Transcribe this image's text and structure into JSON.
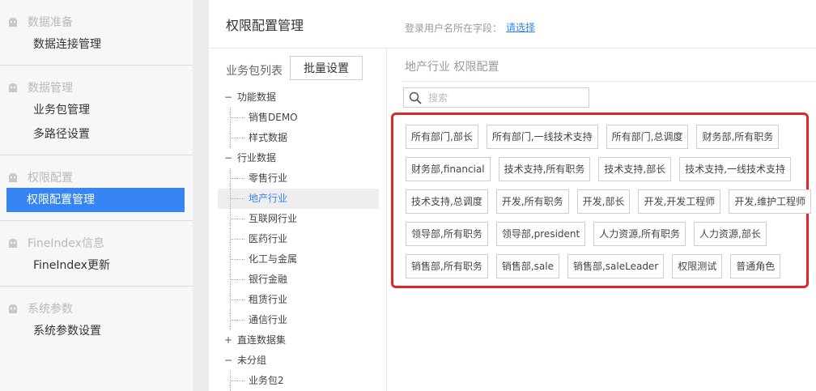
{
  "sidebar": {
    "groups": [
      {
        "header": "数据准备",
        "items": [
          {
            "label": "数据连接管理",
            "active": false
          }
        ]
      },
      {
        "header": "数据管理",
        "items": [
          {
            "label": "业务包管理",
            "active": false
          },
          {
            "label": "多路径设置",
            "active": false
          }
        ]
      },
      {
        "header": "权限配置",
        "items": [
          {
            "label": "权限配置管理",
            "active": true
          }
        ]
      },
      {
        "header": "FineIndex信息",
        "items": [
          {
            "label": "FineIndex更新",
            "active": false
          }
        ]
      },
      {
        "header": "系统参数",
        "items": [
          {
            "label": "系统参数设置",
            "active": false
          }
        ]
      }
    ]
  },
  "topbar": {
    "title": "权限配置管理",
    "field_label": "登录用户名所在字段：",
    "field_link": "请选择"
  },
  "leftpane": {
    "list_label": "业务包列表",
    "batch_button": "批量设置"
  },
  "tree": [
    {
      "label": "功能数据",
      "type": "parent",
      "toggle": "−"
    },
    {
      "label": "销售DEMO",
      "type": "child"
    },
    {
      "label": "样式数据",
      "type": "child"
    },
    {
      "label": "行业数据",
      "type": "parent",
      "toggle": "−"
    },
    {
      "label": "零售行业",
      "type": "child"
    },
    {
      "label": "地产行业",
      "type": "child",
      "selected": true
    },
    {
      "label": "互联网行业",
      "type": "child"
    },
    {
      "label": "医药行业",
      "type": "child"
    },
    {
      "label": "化工与金属",
      "type": "child"
    },
    {
      "label": "银行金融",
      "type": "child"
    },
    {
      "label": "租赁行业",
      "type": "child"
    },
    {
      "label": "通信行业",
      "type": "child"
    },
    {
      "label": "直连数据集",
      "type": "parent",
      "toggle": "+"
    },
    {
      "label": "未分组",
      "type": "parent",
      "toggle": "−"
    },
    {
      "label": "业务包2",
      "type": "child"
    }
  ],
  "rightpane": {
    "section_title": "地产行业 权限配置",
    "search_placeholder": "搜索",
    "role_rows": [
      [
        "所有部门,部长",
        "所有部门,一线技术支持",
        "所有部门,总调度",
        "财务部,所有职务"
      ],
      [
        "财务部,financial",
        "技术支持,所有职务",
        "技术支持,部长",
        "技术支持,一线技术支持"
      ],
      [
        "技术支持,总调度",
        "开发,所有职务",
        "开发,部长",
        "开发,开发工程师",
        "开发,维护工程师"
      ],
      [
        "领导部,所有职务",
        "领导部,president",
        "人力资源,所有职务",
        "人力资源,部长"
      ],
      [
        "销售部,所有职务",
        "销售部,sale",
        "销售部,saleLeader",
        "权限测试",
        "普通角色"
      ]
    ]
  },
  "colors": {
    "accent": "#3685f2",
    "highlight_border": "#e0262b",
    "sidebar_bg": "#f7f7f7"
  }
}
